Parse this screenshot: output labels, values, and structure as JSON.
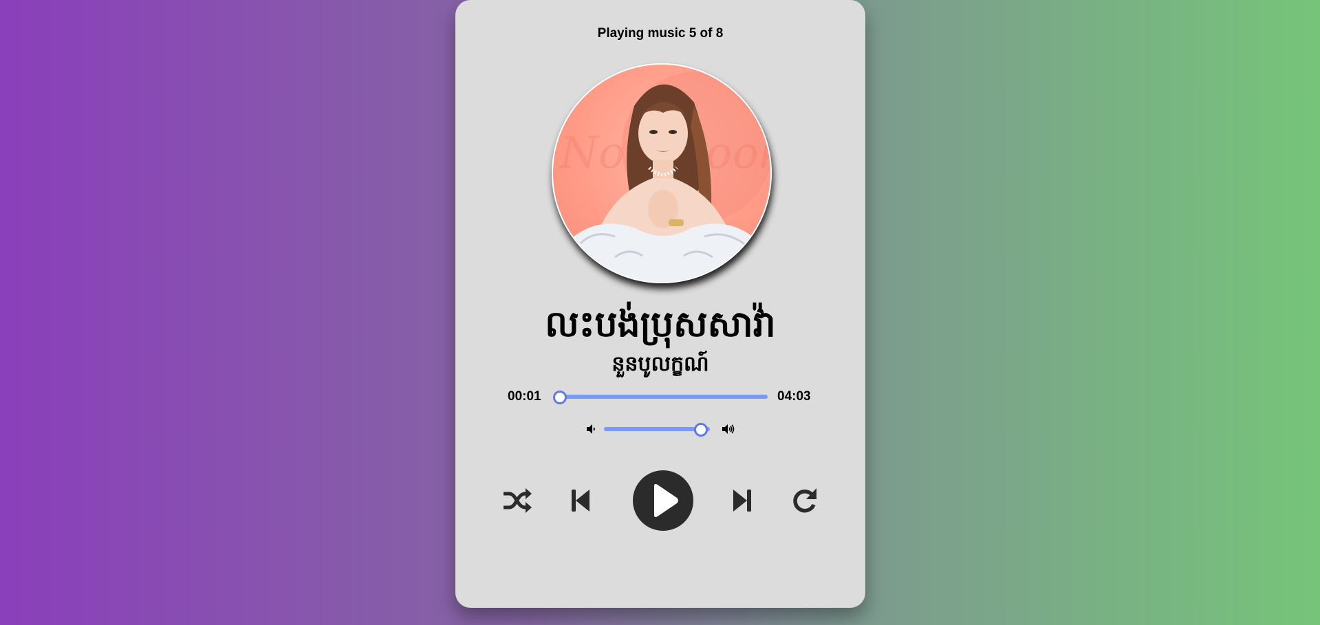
{
  "player": {
    "status": "Playing music 5 of 8",
    "song_title": "លះបង់ប្រុសសាវ៉ា",
    "artist": "នួនបូលក្ខណ៍",
    "current_time": "00:01",
    "total_time": "04:03",
    "progress": 0.0,
    "volume": 0.9
  },
  "cover_watermark": "Now Look",
  "colors": {
    "card_bg": "#dcdcdc",
    "slider": "#7a98f5",
    "slider_thumb_border": "#5f79e8",
    "controls": "#2b2b2b",
    "gradient_left": "#8a3fbb",
    "gradient_right": "#76c47a"
  },
  "icons": {
    "shuffle": "shuffle-icon",
    "previous": "step-backward-icon",
    "play": "play-icon",
    "next": "step-forward-icon",
    "repeat": "redo-icon",
    "volume_down": "volume-down-icon",
    "volume_up": "volume-up-icon"
  }
}
